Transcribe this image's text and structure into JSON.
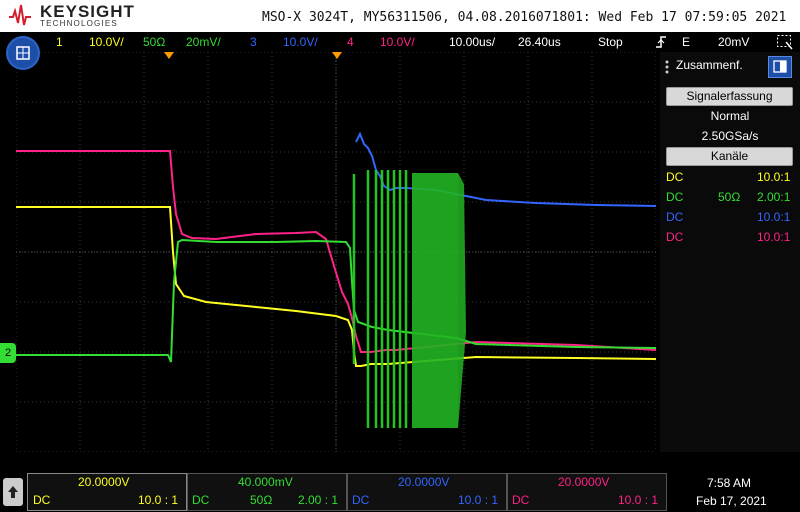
{
  "header": {
    "brand": "KEYSIGHT",
    "brand_sub": "TECHNOLOGIES",
    "title": "MSO-X 3024T, MY56311506, 04.08.2016071801: Wed Feb 17 07:59:05 2021"
  },
  "channel_bar": {
    "ch1_num": "1",
    "ch1_scale": "10.0V/",
    "ch2_imp": "50Ω",
    "ch2_scale": "20mV/",
    "ch3_num": "3",
    "ch3_scale": "10.0V/",
    "ch4_num": "4",
    "ch4_scale": "10.0V/",
    "timebase": "10.00us/",
    "delay": "26.40us",
    "run_state": "Stop",
    "trig_mode": "E",
    "trig_level": "20mV"
  },
  "side_panel": {
    "title": "Zusammenf.",
    "signal_button": "Signalerfassung",
    "acq_mode": "Normal",
    "sample_rate": "2.50GSa/s",
    "channels_button": "Kanäle",
    "rows": [
      {
        "coupling": "DC",
        "imp": "",
        "probe": "10.0:1",
        "color": "#ffff22"
      },
      {
        "coupling": "DC",
        "imp": "50Ω",
        "probe": "2.00:1",
        "color": "#33dd33"
      },
      {
        "coupling": "DC",
        "imp": "",
        "probe": "10.0:1",
        "color": "#3366ff"
      },
      {
        "coupling": "DC",
        "imp": "",
        "probe": "10.0:1",
        "color": "#ff2288"
      }
    ]
  },
  "ground_marker": "2",
  "bottom": {
    "ch1": {
      "offset": "20.0000V",
      "coupling": "DC",
      "probe": "10.0 : 1"
    },
    "ch2": {
      "offset": "40.000mV",
      "coupling": "DC",
      "imp": "50Ω",
      "probe": "2.00 : 1"
    },
    "ch3": {
      "offset": "20.0000V",
      "coupling": "DC",
      "probe": "10.0 : 1"
    },
    "ch4": {
      "offset": "20.0000V",
      "coupling": "DC",
      "probe": "10.0 : 1"
    },
    "time": "7:58 AM",
    "date": "Feb 17, 2021"
  },
  "colors": {
    "ch1": "#ffff22",
    "ch2": "#33dd33",
    "ch3": "#3366ff",
    "ch4": "#ff2288"
  }
}
